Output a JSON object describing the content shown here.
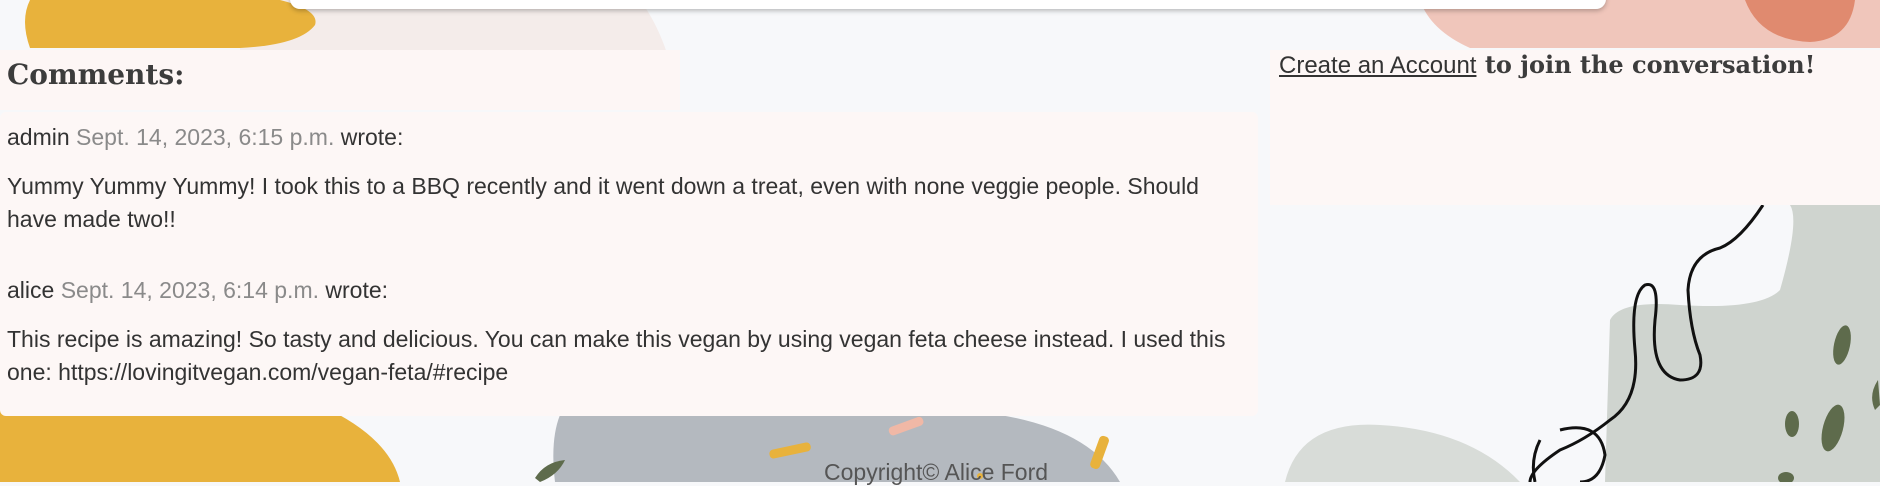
{
  "comments_section": {
    "title": "Comments:",
    "items": [
      {
        "author": "admin",
        "date": "Sept. 14, 2023, 6:15 p.m.",
        "wrote_label": "wrote:",
        "body": "Yummy Yummy Yummy! I took this to a BBQ recently and it went down a treat, even with none veggie people. Should have made two!!"
      },
      {
        "author": "alice",
        "date": "Sept. 14, 2023, 6:14 p.m.",
        "wrote_label": "wrote:",
        "body": "This recipe is amazing! So tasty and delicious. You can make this vegan by using vegan feta cheese instead. I used this one: https://lovingitvegan.com/vegan-feta/#recipe"
      }
    ]
  },
  "sidebar": {
    "create_account_link": "Create an Account",
    "join_text": " to join the conversation!"
  },
  "footer": {
    "copyright": "Copyright© Alice Ford"
  },
  "colors": {
    "panel_bg": "#fdf7f6",
    "mustard": "#e8b23c",
    "sage": "#cfd4cf",
    "olive": "#5e6b4c",
    "blush": "#f0c6bb",
    "terracotta": "#e08a6f",
    "slate": "#b4b9bf"
  }
}
